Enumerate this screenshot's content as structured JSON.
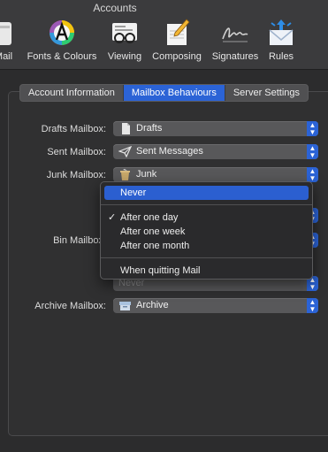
{
  "window": {
    "title": "Accounts"
  },
  "toolbar": {
    "items": [
      {
        "label": "Mail",
        "icon": "mail-icon"
      },
      {
        "label": "Fonts & Colours",
        "icon": "fonts-colours-icon"
      },
      {
        "label": "Viewing",
        "icon": "viewing-glasses-icon"
      },
      {
        "label": "Composing",
        "icon": "composing-pencil-icon"
      },
      {
        "label": "Signatures",
        "icon": "signature-icon"
      },
      {
        "label": "Rules",
        "icon": "rules-envelope-icon"
      }
    ]
  },
  "tabs": {
    "items": [
      {
        "label": "Account Information"
      },
      {
        "label": "Mailbox Behaviours"
      },
      {
        "label": "Server Settings"
      }
    ],
    "active": "Mailbox Behaviours"
  },
  "form": {
    "drafts": {
      "label": "Drafts Mailbox:",
      "value": "Drafts",
      "icon": "document-icon"
    },
    "sent": {
      "label": "Sent Mailbox:",
      "value": "Sent Messages",
      "icon": "paper-plane-icon"
    },
    "junk": {
      "label": "Junk Mailbox:",
      "value": "Junk",
      "icon": "junk-bin-icon"
    },
    "bin": {
      "label": "Bin Mailbox:"
    },
    "bin_erase": {
      "value": "Never"
    },
    "archive": {
      "label": "Archive Mailbox:",
      "value": "Archive",
      "icon": "archive-box-icon"
    }
  },
  "menu": {
    "items": [
      {
        "label": "Never"
      },
      {
        "label": "After one day"
      },
      {
        "label": "After one week"
      },
      {
        "label": "After one month"
      },
      {
        "label": "When quitting Mail"
      }
    ],
    "highlighted": "Never",
    "checked": "After one day"
  },
  "colors": {
    "accent": "#2b63d6",
    "window_bg": "#323233",
    "popup_bg": "#58585a",
    "menu_bg": "#2a2a2c"
  }
}
